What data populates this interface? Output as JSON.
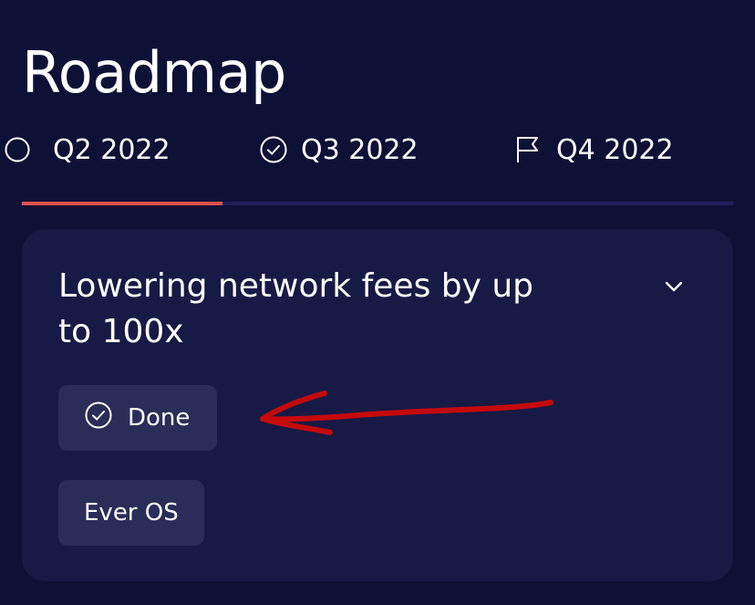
{
  "page": {
    "title": "Roadmap"
  },
  "tabs": [
    {
      "label": "Q2 2022",
      "icon": "check-circle-icon"
    },
    {
      "label": "Q3 2022",
      "icon": "check-circle-icon"
    },
    {
      "label": "Q4 2022",
      "icon": "flag-icon"
    }
  ],
  "progress": {
    "active_tab": "Q2 2022",
    "fill_fraction": 0.28
  },
  "card": {
    "title": "Lowering network fees by up to 100x",
    "expand_icon": "chevron-down-icon",
    "tags": [
      {
        "label": "Done",
        "icon": "check-circle-icon"
      },
      {
        "label": "Ever OS"
      }
    ]
  },
  "colors": {
    "background": "#0e1136",
    "card": "#171a45",
    "chip": "#2a2d57",
    "accent": "#e4524b",
    "track": "#211f5e",
    "annotation": "#c40a0a"
  }
}
